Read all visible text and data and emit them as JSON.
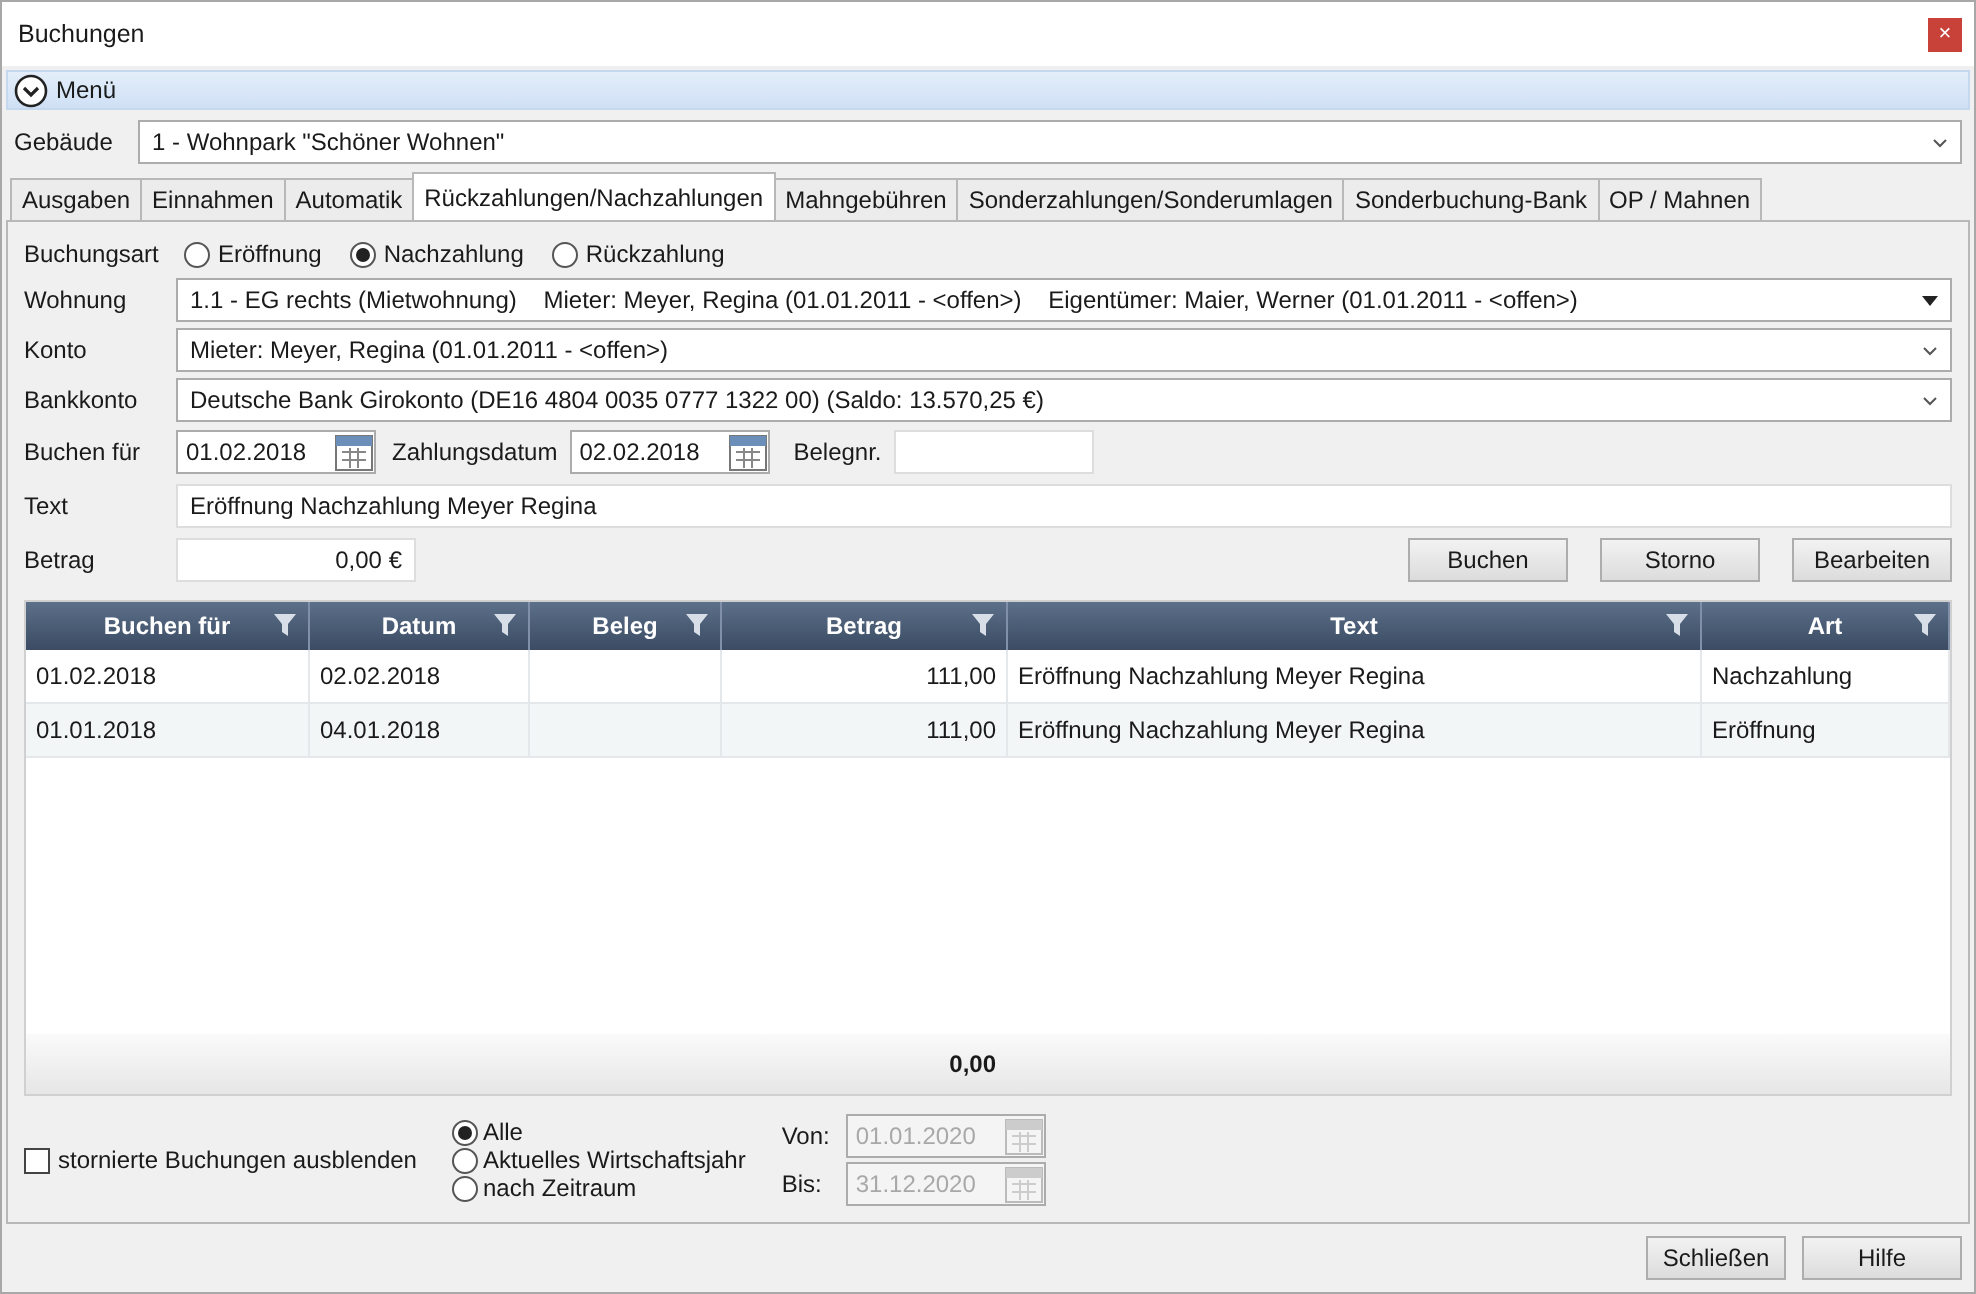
{
  "window": {
    "title": "Buchungen",
    "close": "×"
  },
  "menu": {
    "label": "Menü"
  },
  "building": {
    "label": "Gebäude",
    "value": "1 - Wohnpark \"Schöner Wohnen\""
  },
  "tabs": [
    {
      "label": "Ausgaben",
      "selected": false
    },
    {
      "label": "Einnahmen",
      "selected": false
    },
    {
      "label": "Automatik",
      "selected": false
    },
    {
      "label": "Rückzahlungen/Nachzahlungen",
      "selected": true
    },
    {
      "label": "Mahngebühren",
      "selected": false
    },
    {
      "label": "Sonderzahlungen/Sonderumlagen",
      "selected": false
    },
    {
      "label": "Sonderbuchung-Bank",
      "selected": false
    },
    {
      "label": "OP / Mahnen",
      "selected": false
    }
  ],
  "booking_type": {
    "label": "Buchungsart",
    "options": [
      {
        "label": "Eröffnung",
        "selected": false
      },
      {
        "label": "Nachzahlung",
        "selected": true
      },
      {
        "label": "Rückzahlung",
        "selected": false
      }
    ]
  },
  "apartment": {
    "label": "Wohnung",
    "value": "1.1 - EG rechts (Mietwohnung)    Mieter: Meyer, Regina (01.01.2011 - <offen>)    Eigentümer: Maier, Werner (01.01.2011 - <offen>)"
  },
  "account": {
    "label": "Konto",
    "value": "Mieter: Meyer, Regina (01.01.2011 - <offen>)"
  },
  "bank_account": {
    "label": "Bankkonto",
    "value": "Deutsche Bank Girokonto (DE16 4804 0035 0777 1322 00) (Saldo: 13.570,25 €)"
  },
  "book_for": {
    "label": "Buchen für",
    "value": "01.02.2018"
  },
  "payment_date": {
    "label": "Zahlungsdatum",
    "value": "02.02.2018"
  },
  "receipt_no": {
    "label": "Belegnr."
  },
  "text": {
    "label": "Text",
    "value": "Eröffnung Nachzahlung Meyer Regina"
  },
  "amount": {
    "label": "Betrag",
    "value": "0,00 €"
  },
  "action_buttons": [
    "Buchen",
    "Storno",
    "Bearbeiten"
  ],
  "table": {
    "columns": [
      "Buchen für",
      "Datum",
      "Beleg",
      "Betrag",
      "Text",
      "Art"
    ],
    "rows": [
      [
        "01.02.2018",
        "02.02.2018",
        "",
        "111,00",
        "Eröffnung Nachzahlung Meyer Regina",
        "Nachzahlung"
      ],
      [
        "01.01.2018",
        "04.01.2018",
        "",
        "111,00",
        "Eröffnung Nachzahlung Meyer Regina",
        "Eröffnung"
      ]
    ],
    "total": "0,00"
  },
  "hide_cancelled": {
    "label": "stornierte Buchungen ausblenden",
    "checked": false
  },
  "period_options": [
    {
      "label": "Alle",
      "selected": true
    },
    {
      "label": "Aktuelles Wirtschaftsjahr",
      "selected": false
    },
    {
      "label": "nach Zeitraum",
      "selected": false
    }
  ],
  "from": {
    "label": "Von:",
    "value": "01.01.2020",
    "disabled": true
  },
  "to": {
    "label": "Bis:",
    "value": "31.12.2020",
    "disabled": true
  },
  "footer_buttons": [
    "Schließen",
    "Hilfe"
  ]
}
